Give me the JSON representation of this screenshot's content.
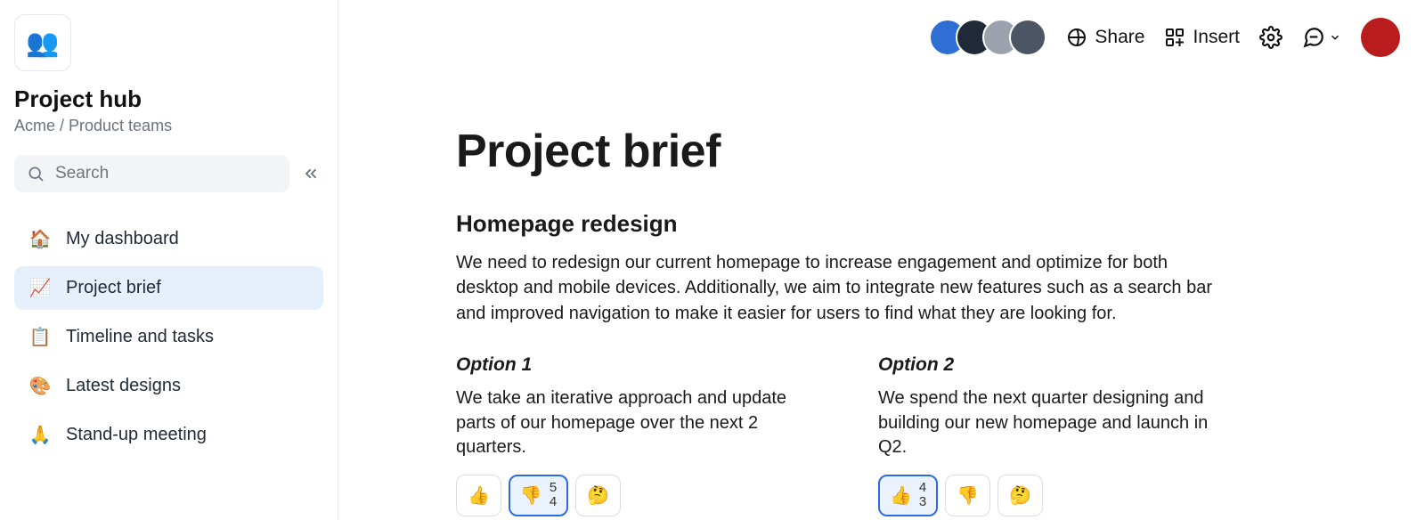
{
  "sidebar": {
    "workspace_icon": "👥",
    "title": "Project hub",
    "subtitle": "Acme / Product teams",
    "search_placeholder": "Search",
    "items": [
      {
        "icon": "🏠",
        "label": "My dashboard"
      },
      {
        "icon": "📈",
        "label": "Project brief"
      },
      {
        "icon": "📋",
        "label": "Timeline and tasks"
      },
      {
        "icon": "🎨",
        "label": "Latest designs"
      },
      {
        "icon": "🙏",
        "label": "Stand-up meeting"
      }
    ],
    "active_index": 1
  },
  "topbar": {
    "share_label": "Share",
    "insert_label": "Insert"
  },
  "doc": {
    "title": "Project brief",
    "section_heading": "Homepage redesign",
    "section_body": "We need to redesign our current homepage to increase engagement and optimize for both desktop and mobile devices. Additionally, we aim to integrate new features such as a search bar and improved navigation to make it easier for users to find what they are looking for.",
    "options": [
      {
        "heading": "Option 1",
        "body": "We take an iterative approach and update parts of our homepage over the next 2 quarters.",
        "reactions": [
          {
            "emoji": "👍",
            "count1": "",
            "count2": "",
            "active": false
          },
          {
            "emoji": "👎",
            "count1": "5",
            "count2": "4",
            "active": true
          },
          {
            "emoji": "🤔",
            "count1": "",
            "count2": "",
            "active": false
          }
        ]
      },
      {
        "heading": "Option 2",
        "body": "We spend the next quarter designing and building our new homepage and launch in Q2.",
        "reactions": [
          {
            "emoji": "👍",
            "count1": "4",
            "count2": "3",
            "active": true
          },
          {
            "emoji": "👎",
            "count1": "",
            "count2": "",
            "active": false
          },
          {
            "emoji": "🤔",
            "count1": "",
            "count2": "",
            "active": false
          }
        ]
      }
    ]
  },
  "collaborators": [
    {
      "bg": "#2F6FD4"
    },
    {
      "bg": "#1F2937"
    },
    {
      "bg": "#9CA3AF"
    },
    {
      "bg": "#4B5563"
    }
  ]
}
